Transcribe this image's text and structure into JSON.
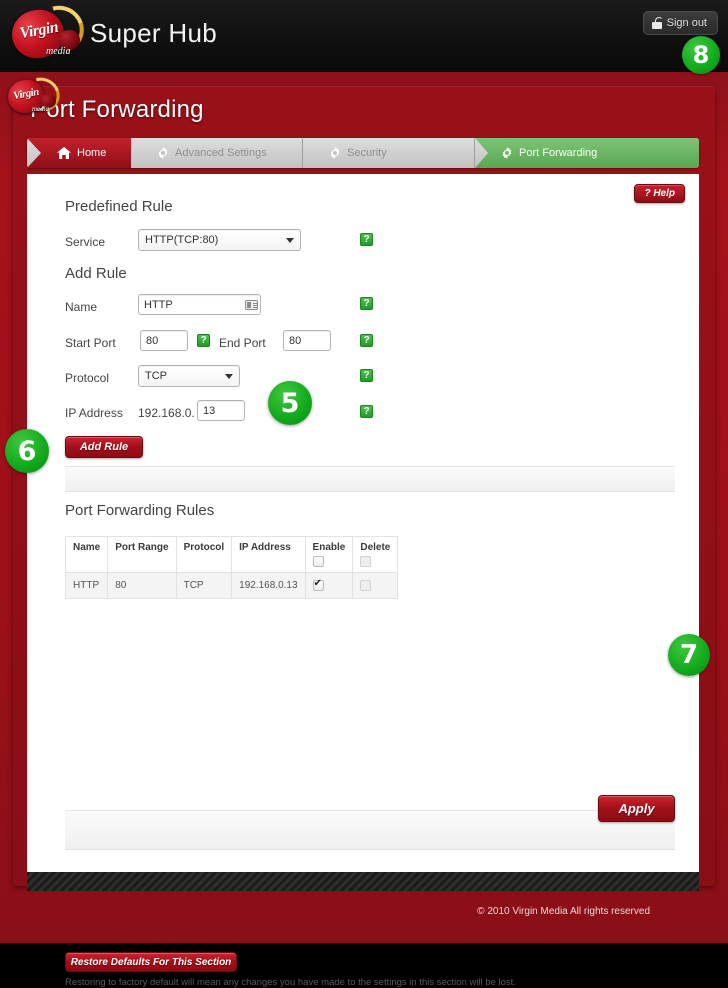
{
  "header": {
    "logo_alt": "Virgin Media",
    "logo_word": "Virgin",
    "logo_sub": "media",
    "app_title": "Super Hub",
    "signout_label": "Sign out"
  },
  "page": {
    "title": "Port Forwarding",
    "help_label": "? Help"
  },
  "breadcrumbs": [
    {
      "label": "Home",
      "icon": "home-icon",
      "state": "home"
    },
    {
      "label": "Advanced Settings",
      "icon": "gear-icon",
      "state": "plain"
    },
    {
      "label": "Security",
      "icon": "gear-icon",
      "state": "plain"
    },
    {
      "label": "Port Forwarding",
      "icon": "gear-icon",
      "state": "active"
    }
  ],
  "predefined": {
    "heading": "Predefined Rule",
    "service_label": "Service",
    "service_value": "HTTP(TCP:80)",
    "help_icon": "?"
  },
  "add_rule": {
    "heading": "Add Rule",
    "name_label": "Name",
    "name_value": "HTTP",
    "start_port_label": "Start Port",
    "start_port_value": "80",
    "end_port_label": "End Port",
    "end_port_value": "80",
    "protocol_label": "Protocol",
    "protocol_value": "TCP",
    "ip_label": "IP Address",
    "ip_prefix": "192.168.0.",
    "ip_host_value": "13",
    "add_button": "Add Rule"
  },
  "rules_table": {
    "heading": "Port Forwarding Rules",
    "columns": [
      "Name",
      "Port Range",
      "Protocol",
      "IP Address",
      "Enable",
      "Delete"
    ],
    "rows": [
      {
        "name": "HTTP",
        "port_range": "80",
        "protocol": "TCP",
        "ip_address": "192.168.0.13",
        "enable": true,
        "delete": false
      }
    ],
    "header_enable_checked": false,
    "header_delete_checked": false
  },
  "actions": {
    "apply_label": "Apply",
    "restore_label": "Restore Defaults For This Section",
    "restore_note": "Restoring to factory default will mean any changes you have made to the settings in this section will be lost."
  },
  "footer": {
    "copyright": "© 2010 Virgin Media  All rights reserved"
  },
  "badges": [
    {
      "number": "8"
    },
    {
      "number": "5"
    },
    {
      "number": "6"
    },
    {
      "number": "7"
    }
  ],
  "colors": {
    "brand_red": "#a3121c",
    "dark_red": "#8d0c14",
    "accent_green": "#11a81b",
    "tab_green": "#6fbb68",
    "black": "#121212"
  }
}
